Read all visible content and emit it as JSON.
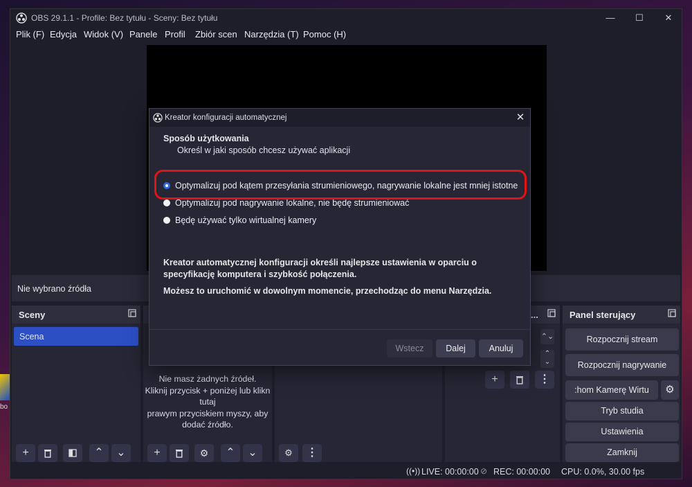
{
  "window": {
    "title": "OBS 29.1.1 - Profile: Bez tytułu - Sceny: Bez tytułu",
    "controls": {
      "minimize": "—",
      "maximize": "☐",
      "close": "✕"
    }
  },
  "menu": [
    "Plik (F)",
    "Edycja",
    "Widok (V)",
    "Panele",
    "Profil",
    "Zbiór scen",
    "Narzędzia (T)",
    "Pomoc (H)"
  ],
  "source_bar": {
    "label": "Nie wybrano źródła"
  },
  "scenes": {
    "title": "Sceny",
    "items": [
      "Scena"
    ]
  },
  "sources": {
    "empty_text": "Nie masz żadnych źródeł.\nKliknij przycisk + poniżej lub klikn\ntutaj\nprawym przyciskiem myszy, aby\ndodać źródło."
  },
  "controls": {
    "title": "Panel sterujący",
    "buttons": [
      "Rozpocznij stream",
      "Rozpocznij nagrywanie",
      ":hom Kamerę Wirtu",
      "Tryb studia",
      "Ustawienia",
      "Zamknij"
    ]
  },
  "status": {
    "live": "LIVE: 00:00:00",
    "rec": "REC: 00:00:00",
    "cpu": "CPU: 0.0%, 30.00 fps"
  },
  "desktop": {
    "side_text": "bo"
  },
  "dialog": {
    "title": "Kreator konfiguracji automatycznej",
    "heading": "Sposób użytkowania",
    "subheading": "Określ w jaki sposób chcesz używać aplikacji",
    "options": [
      {
        "label": "Optymalizuj pod kątem przesyłania strumieniowego, nagrywanie lokalne jest mniej istotne",
        "selected": true
      },
      {
        "label": "Optymalizuj pod nagrywanie lokalne, nie będę strumieniować",
        "selected": false
      },
      {
        "label": "Będę używać tylko wirtualnej kamery",
        "selected": false
      }
    ],
    "info_1": "Kreator automatycznej konfiguracji określi najlepsze ustawienia w oparciu o specyfikację komputera i szybkość połączenia.",
    "info_2": "Możesz to uruchomić w dowolnym momencie, przechodząc do menu Narzędzia.",
    "buttons": {
      "back": "Wstecz",
      "next": "Dalej",
      "cancel": "Anuluj"
    }
  },
  "colors": {
    "accent": "#2b6cde",
    "highlight": "#e01414",
    "scene_selected": "#2c50c4"
  }
}
